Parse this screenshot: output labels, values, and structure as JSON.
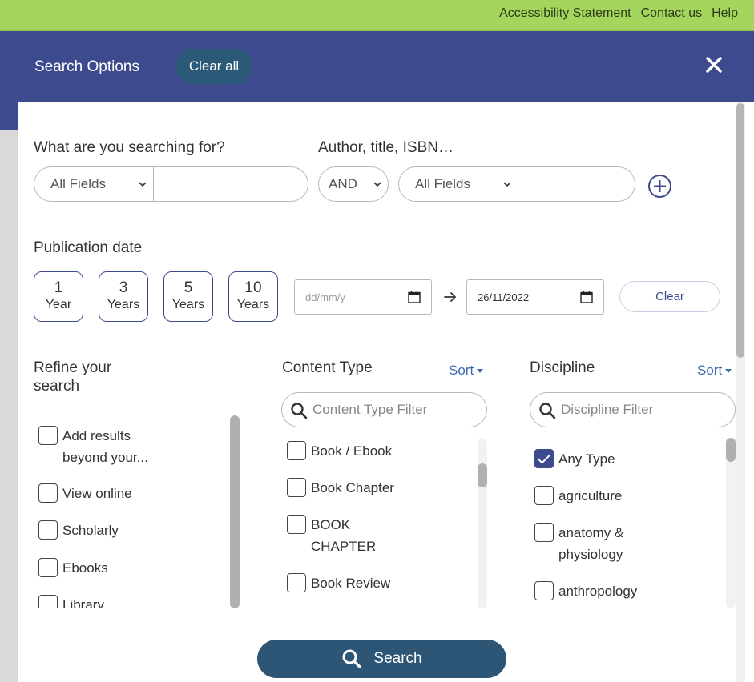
{
  "top_links": [
    "Accessibility Statement",
    "Contact us",
    "Help"
  ],
  "modal": {
    "title": "Search Options",
    "clear_all": "Clear all"
  },
  "search": {
    "label1": "What are you searching for?",
    "label2": "Author, title, ISBN…",
    "field_select_1": "All Fields",
    "operator_select": "AND",
    "field_select_2": "All Fields",
    "input1_value": "",
    "input2_value": ""
  },
  "publication_date": {
    "label": "Publication date",
    "ranges": [
      {
        "num": "1",
        "unit": "Year"
      },
      {
        "num": "3",
        "unit": "Years"
      },
      {
        "num": "5",
        "unit": "Years"
      },
      {
        "num": "10",
        "unit": "Years"
      }
    ],
    "from_placeholder": "dd/mm/y",
    "to_value": "26/11/2022",
    "clear": "Clear"
  },
  "refine": {
    "title": "Refine your search",
    "items": [
      {
        "label": "Add results beyond your...",
        "checked": false
      },
      {
        "label": "View online",
        "checked": false
      },
      {
        "label": "Scholarly",
        "checked": false
      },
      {
        "label": "Ebooks",
        "checked": false
      },
      {
        "label": "Library",
        "checked": false
      }
    ]
  },
  "content_type": {
    "title": "Content Type",
    "sort": "Sort",
    "filter_placeholder": "Content Type Filter",
    "items": [
      {
        "label": "Book / Ebook",
        "checked": false
      },
      {
        "label": "Book Chapter",
        "checked": false
      },
      {
        "label": "BOOK CHAPTER",
        "checked": false
      },
      {
        "label": "Book Review",
        "checked": false
      }
    ]
  },
  "discipline": {
    "title": "Discipline",
    "sort": "Sort",
    "filter_placeholder": "Discipline Filter",
    "items": [
      {
        "label": "Any Type",
        "checked": true
      },
      {
        "label": "agriculture",
        "checked": false
      },
      {
        "label": "anatomy & physiology",
        "checked": false
      },
      {
        "label": "anthropology",
        "checked": false
      }
    ]
  },
  "search_button": "Search",
  "colors": {
    "top_bar": "#a4d65e",
    "header": "#3e4a8e",
    "clear_all_bg": "#2a5a77",
    "search_button": "#2d5576",
    "link": "#3e6ab0"
  }
}
